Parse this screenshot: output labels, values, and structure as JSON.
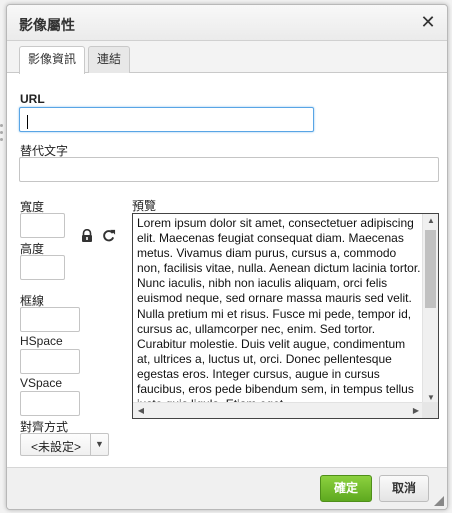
{
  "dialog": {
    "title": "影像屬性",
    "close_glyph": "✕"
  },
  "tabs": [
    {
      "label": "影像資訊",
      "active": true
    },
    {
      "label": "連結",
      "active": false
    }
  ],
  "fields": {
    "url_label": "URL",
    "url_value": "",
    "alt_label": "替代文字",
    "alt_value": "",
    "width_label": "寬度",
    "height_label": "高度",
    "border_label": "框線",
    "hspace_label": "HSpace",
    "vspace_label": "VSpace",
    "align_label": "對齊方式",
    "align_value": "<未設定>"
  },
  "icons": {
    "lock": "lock-icon",
    "reset": "reset-size-icon"
  },
  "preview": {
    "label": "預覽",
    "text": "Lorem ipsum dolor sit amet, consectetuer adipiscing elit. Maecenas feugiat consequat diam. Maecenas metus. Vivamus diam purus, cursus a, commodo non, facilisis vitae, nulla. Aenean dictum lacinia tortor. Nunc iaculis, nibh non iaculis aliquam, orci felis euismod neque, sed ornare massa mauris sed velit. Nulla pretium mi et risus. Fusce mi pede, tempor id, cursus ac, ullamcorper nec, enim. Sed tortor. Curabitur molestie. Duis velit augue, condimentum at, ultrices a, luctus ut, orci. Donec pellentesque egestas eros. Integer cursus, augue in cursus faucibus, eros pede bibendum sem, in tempus tellus justo quis ligula. Etiam eget"
  },
  "buttons": {
    "ok": "確定",
    "cancel": "取消"
  },
  "colors": {
    "accent_ok": "#6ab42a",
    "focus_border": "#59a5e5"
  }
}
